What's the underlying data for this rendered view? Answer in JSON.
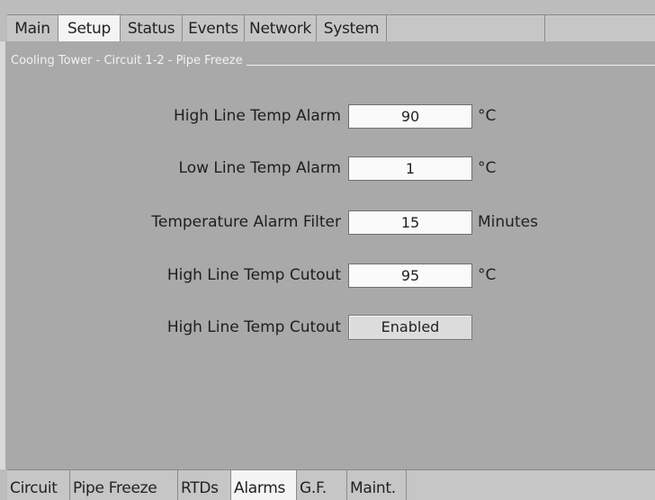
{
  "top_tabs": [
    "Main",
    "Setup",
    "Status",
    "Events",
    "Network",
    "System"
  ],
  "active_top_tab": "Setup",
  "section_title": "Cooling Tower - Circuit 1-2 - Pipe Freeze",
  "settings": [
    {
      "label": "High Line Temp Alarm",
      "value": "90",
      "unit": "°C"
    },
    {
      "label": "Low Line Temp Alarm",
      "value": "1",
      "unit": "°C"
    },
    {
      "label": "Temperature Alarm Filter",
      "value": "15",
      "unit": "Minutes"
    },
    {
      "label": "High Line Temp Cutout",
      "value": "95",
      "unit": "°C"
    }
  ],
  "cutout_toggle": {
    "label": "High Line Temp Cutout",
    "value": "Enabled"
  },
  "bottom_tabs": [
    "Circuit",
    "Pipe Freeze",
    "RTDs",
    "Alarms",
    "G.F.",
    "Maint."
  ],
  "active_bottom_tab": "Alarms"
}
